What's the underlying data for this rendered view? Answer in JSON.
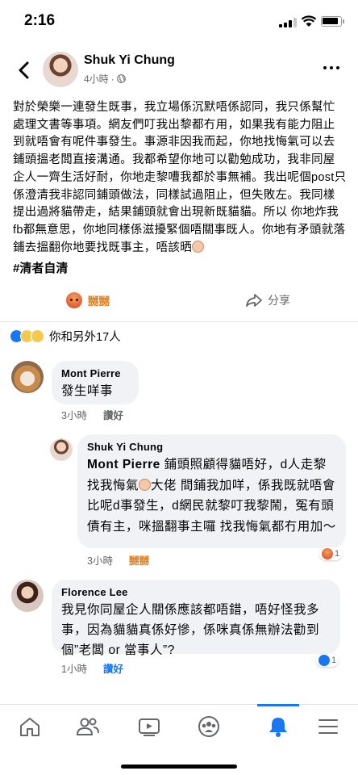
{
  "status_bar": {
    "time": "2:16"
  },
  "post": {
    "author": "Shuk Yi Chung",
    "time_ago": "4小時",
    "meta_separator": "·",
    "body": "對於榮樂一連發生既事，我立場係沉默唔係認同，我只係幫忙處理文書等事項。網友們叮我出黎都冇用，如果我有能力阻止到就唔會有呢件事發生。事源非因我而起，你地找悔氣可以去鋪頭搵老闆直接溝通。我都希望你地可以勸勉成功，我非同屋企人一齊生活好耐，你地走黎嘈我都於事無補。我出呢個post只係澄清我非認同鋪頭做法，同樣試過阻止，但失敗左。我同樣提出過將貓帶走，結果鋪頭就會出現新既貓貓。所以 你地炸我fb都無意思，你地同樣係滋擾緊個唔關事既人。你地有矛頭就落鋪去搵翻你地要找既事主，唔該晒",
    "hashtag": "#清者自清",
    "angry_label": "嬲嬲",
    "share_label": "分享"
  },
  "reactions": {
    "summary": "你和另外17人",
    "icons": [
      "like-icon",
      "wow-icon",
      "sad-icon"
    ]
  },
  "comments": [
    {
      "author": "Mont Pierre",
      "text": "發生咩事",
      "time": "3小時",
      "action": "讚好"
    },
    {
      "author": "Shuk Yi Chung",
      "mention": "Mont Pierre",
      "text_parts": [
        " 鋪頭照顧得貓唔好，d人走黎找我悔氣",
        "大佬 間鋪我加咩，係我既就唔會比呢d事發生，d網民就黎叮我黎鬧，冤有頭債有主，咪搵翻事主囉 找我悔氣都冇用加～"
      ],
      "time": "3小時",
      "action": "嬲嬲",
      "reaction_count": "1"
    },
    {
      "author": "Florence Lee",
      "text": "我見你同屋企人關係應該都唔錯，唔好怪我多事，因為貓貓真係好慘，係咪真係無辦法勸到個”老闆 or 當事人”?",
      "time": "1小時",
      "action": "讚好",
      "reaction_count": "1"
    }
  ],
  "nav": {
    "items": [
      "home-icon",
      "friends-icon",
      "watch-icon",
      "groups-icon",
      "notifications-icon",
      "menu-icon"
    ],
    "active": "notifications-icon"
  },
  "colors": {
    "accent": "#1877f2",
    "angry": "#e4801c",
    "bubble": "#f0f2f5",
    "meta": "#65676b"
  }
}
